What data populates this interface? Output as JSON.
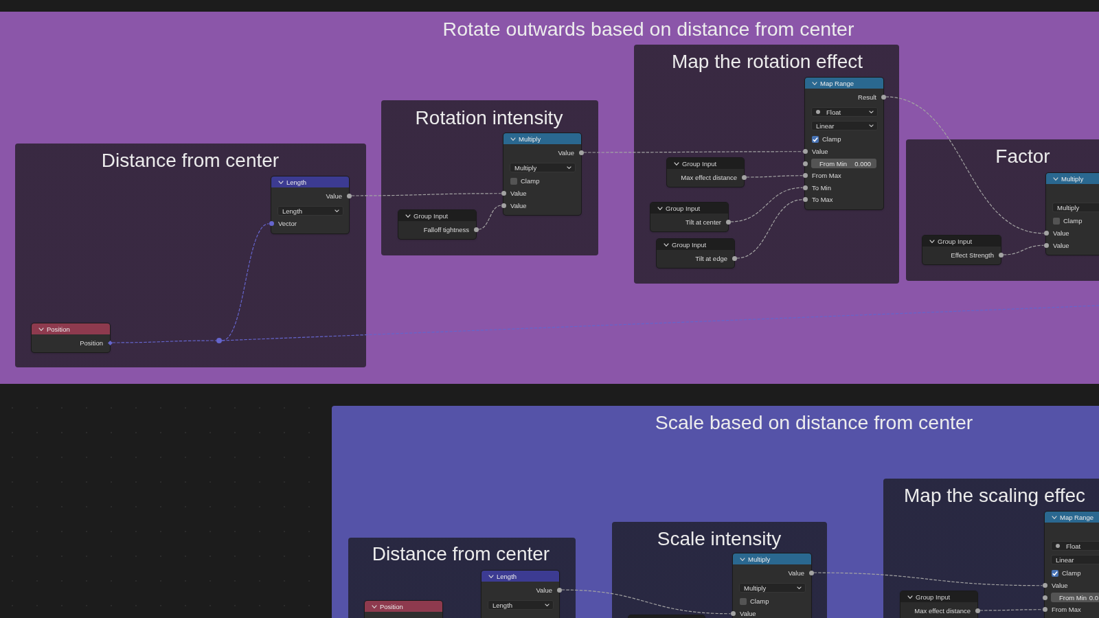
{
  "frames": [
    {
      "title": "Rotate outwards based on distance from center",
      "color": "#8b56a9",
      "frames": [
        {
          "title": "Distance from center",
          "nodes": [
            {
              "kind": "vector_math",
              "title": "Length",
              "expanded": true,
              "rows": [
                {
                  "kind": "output",
                  "label": "Value",
                  "socket": {
                    "kind": "float"
                  }
                },
                {
                  "kind": "dropdown",
                  "value": "Length"
                },
                {
                  "kind": "input",
                  "label": "Vector",
                  "socket": {
                    "kind": "vector"
                  },
                  "linked": true
                }
              ]
            },
            {
              "kind": "input",
              "title": "Position",
              "expanded": true,
              "rows": [
                {
                  "kind": "output",
                  "label": "Position",
                  "socket": {
                    "kind": "vector_field"
                  }
                }
              ]
            },
            {
              "kind": "reroute",
              "socket": {
                "kind": "vector"
              }
            }
          ]
        },
        {
          "title": "Rotation intensity",
          "nodes": [
            {
              "kind": "math",
              "title": "Multiply",
              "expanded": true,
              "rows": [
                {
                  "kind": "output",
                  "label": "Value",
                  "socket": {
                    "kind": "float"
                  }
                },
                {
                  "kind": "dropdown",
                  "value": "Multiply"
                },
                {
                  "kind": "checkbox",
                  "label": "Clamp",
                  "checked": false
                },
                {
                  "kind": "input",
                  "label": "Value",
                  "socket": {
                    "kind": "float"
                  },
                  "linked": true
                },
                {
                  "kind": "input",
                  "label": "Value",
                  "socket": {
                    "kind": "float"
                  },
                  "linked": true
                }
              ]
            },
            {
              "kind": "group_input",
              "title": "Group Input",
              "expanded": true,
              "rows": [
                {
                  "kind": "output",
                  "label": "Falloff tightness",
                  "socket": {
                    "kind": "float"
                  }
                }
              ]
            }
          ]
        },
        {
          "title": "Map the rotation effect",
          "nodes": [
            {
              "kind": "map_range",
              "title": "Map Range",
              "expanded": true,
              "rows": [
                {
                  "kind": "output",
                  "label": "Result",
                  "socket": {
                    "kind": "float"
                  }
                },
                {
                  "kind": "type_dropdown",
                  "value": "Float"
                },
                {
                  "kind": "dropdown",
                  "value": "Linear"
                },
                {
                  "kind": "checkbox",
                  "label": "Clamp",
                  "checked": true
                },
                {
                  "kind": "input",
                  "label": "Value",
                  "socket": {
                    "kind": "float"
                  },
                  "linked": true
                },
                {
                  "kind": "field",
                  "label": "From Min",
                  "value": "0.000",
                  "socket": {
                    "kind": "float"
                  }
                },
                {
                  "kind": "input",
                  "label": "From Max",
                  "socket": {
                    "kind": "float"
                  },
                  "linked": true
                },
                {
                  "kind": "input",
                  "label": "To Min",
                  "socket": {
                    "kind": "float"
                  },
                  "linked": true
                },
                {
                  "kind": "input",
                  "label": "To Max",
                  "socket": {
                    "kind": "float"
                  },
                  "linked": true
                }
              ]
            },
            {
              "kind": "group_input",
              "title": "Group Input",
              "expanded": true,
              "rows": [
                {
                  "kind": "output",
                  "label": "Max effect distance",
                  "socket": {
                    "kind": "float"
                  }
                }
              ]
            },
            {
              "kind": "group_input",
              "title": "Group Input",
              "expanded": true,
              "rows": [
                {
                  "kind": "output",
                  "label": "Tilt at center",
                  "socket": {
                    "kind": "float"
                  }
                }
              ]
            },
            {
              "kind": "group_input",
              "title": "Group Input",
              "expanded": true,
              "rows": [
                {
                  "kind": "output",
                  "label": "Tilt at edge",
                  "socket": {
                    "kind": "float"
                  }
                }
              ]
            }
          ]
        },
        {
          "title": "Factor",
          "nodes": [
            {
              "kind": "math",
              "title": "Multiply",
              "expanded": true,
              "rows": [
                {
                  "kind": "dropdown",
                  "value": "Multiply"
                },
                {
                  "kind": "checkbox",
                  "label": "Clamp",
                  "checked": false
                },
                {
                  "kind": "input",
                  "label": "Value",
                  "socket": {
                    "kind": "float"
                  },
                  "linked": true
                },
                {
                  "kind": "input",
                  "label": "Value",
                  "socket": {
                    "kind": "float"
                  },
                  "linked": true
                }
              ]
            },
            {
              "kind": "group_input",
              "title": "Group Input",
              "expanded": true,
              "rows": [
                {
                  "kind": "output",
                  "label": "Effect Strength",
                  "socket": {
                    "kind": "float"
                  }
                }
              ]
            }
          ]
        }
      ]
    },
    {
      "title": "Scale based on distance from center",
      "color": "#5553a8",
      "frames": [
        {
          "title": "Distance from center",
          "nodes": [
            {
              "kind": "input",
              "title": "Position",
              "expanded": true
            },
            {
              "kind": "vector_math",
              "title": "Length",
              "expanded": true,
              "rows": [
                {
                  "kind": "output",
                  "label": "Value",
                  "socket": {
                    "kind": "float"
                  }
                },
                {
                  "kind": "dropdown",
                  "value": "Length"
                }
              ]
            }
          ]
        },
        {
          "title": "Scale intensity",
          "nodes": [
            {
              "kind": "math",
              "title": "Multiply",
              "expanded": true,
              "rows": [
                {
                  "kind": "output",
                  "label": "Value",
                  "socket": {
                    "kind": "float"
                  }
                },
                {
                  "kind": "dropdown",
                  "value": "Multiply"
                },
                {
                  "kind": "checkbox",
                  "label": "Clamp",
                  "checked": false
                },
                {
                  "kind": "input",
                  "label": "Value",
                  "socket": {
                    "kind": "float"
                  },
                  "linked": true
                }
              ]
            },
            {
              "kind": "group_input"
            }
          ]
        },
        {
          "title": "Map the scaling effec",
          "nodes": [
            {
              "kind": "group_input",
              "title": "Group Input",
              "expanded": true,
              "rows": [
                {
                  "kind": "output",
                  "label": "Max effect distance",
                  "socket": {
                    "kind": "float"
                  }
                }
              ]
            },
            {
              "kind": "map_range",
              "title": "Map Range",
              "expanded": true,
              "rows": [
                {
                  "kind": "type_dropdown",
                  "value": "Float"
                },
                {
                  "kind": "dropdown",
                  "value": "Linear"
                },
                {
                  "kind": "checkbox",
                  "label": "Clamp",
                  "checked": true
                },
                {
                  "kind": "input",
                  "label": "Value",
                  "socket": {
                    "kind": "float"
                  },
                  "linked": true
                },
                {
                  "kind": "field",
                  "label": "From Min",
                  "value": "0.0",
                  "socket": {
                    "kind": "float"
                  }
                },
                {
                  "kind": "input",
                  "label": "From Max",
                  "socket": {
                    "kind": "float"
                  },
                  "linked": true
                }
              ]
            }
          ]
        }
      ]
    }
  ]
}
